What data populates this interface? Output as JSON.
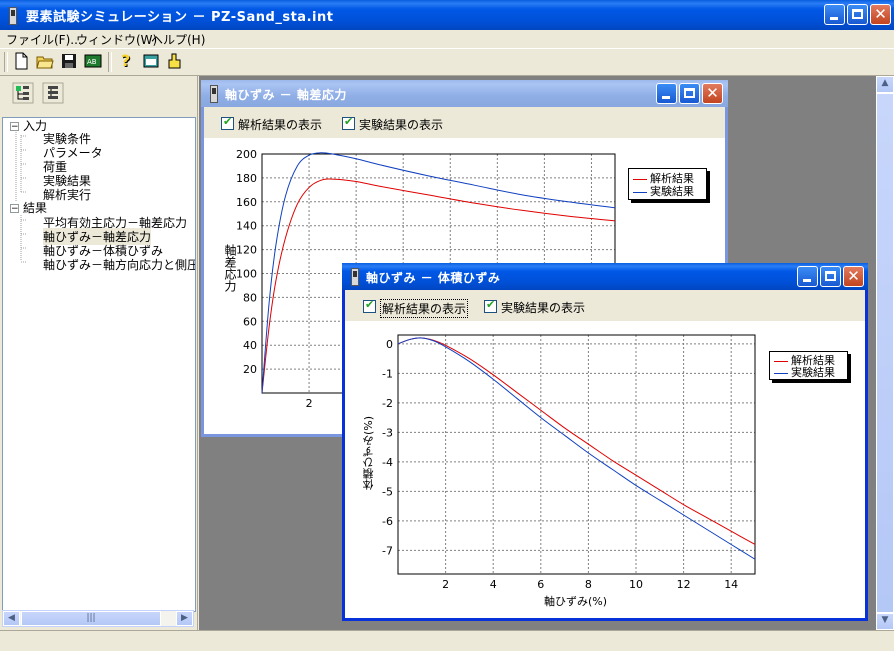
{
  "window": {
    "title": "要素試験シミュレーション － PZ-Sand_sta.int"
  },
  "menu": [
    "ファイル(F)...",
    "ウィンドウ(W)",
    "ヘルプ(H)"
  ],
  "toolbar": {
    "icons": [
      "new-file-icon",
      "open-folder-icon",
      "save-icon",
      "run-icon",
      "help-icon",
      "window-icon",
      "user-icon"
    ]
  },
  "tree": {
    "nodes": [
      {
        "label": "入力",
        "expander": "−"
      },
      {
        "label": "実験条件"
      },
      {
        "label": "パラメータ"
      },
      {
        "label": "荷重"
      },
      {
        "label": "実験結果"
      },
      {
        "label": "解析実行"
      },
      {
        "label": "結果",
        "expander": "−"
      },
      {
        "label": "平均有効主応力－軸差応力"
      },
      {
        "label": "軸ひずみ－軸差応力"
      },
      {
        "label": "軸ひずみ－体積ひずみ"
      },
      {
        "label": "軸ひずみ－軸方向応力と側圧"
      }
    ]
  },
  "win1": {
    "title": "軸ひずみ － 軸差応力",
    "check1": "解析結果の表示",
    "check2": "実験結果の表示",
    "ylabel": "軸差応力",
    "legend": [
      "解析結果",
      "実験結果"
    ]
  },
  "win2": {
    "title": "軸ひずみ － 体積ひずみ",
    "check1": "解析結果の表示",
    "check2": "実験結果の表示",
    "xlabel": "軸ひずみ(%)",
    "ylabel": "体積ひずみ(%)",
    "legend": [
      "解析結果",
      "実験結果"
    ]
  },
  "colors": {
    "analysis": "#e00000",
    "experiment": "#1040c0"
  },
  "chart_data": [
    {
      "type": "line",
      "title": "",
      "xlabel": "",
      "ylabel": "軸差応力",
      "x_ticks_visible": [
        2
      ],
      "y_ticks": [
        20,
        40,
        60,
        80,
        100,
        120,
        140,
        160,
        180,
        200
      ],
      "xlim": [
        0,
        15
      ],
      "ylim": [
        0,
        200
      ],
      "grid": true,
      "legend_position": "right",
      "series": [
        {
          "name": "解析結果",
          "x": [
            0,
            0.3,
            0.6,
            1,
            1.5,
            2,
            2.5,
            3,
            4,
            5,
            7,
            9,
            11,
            13,
            15
          ],
          "y": [
            0,
            55,
            95,
            130,
            158,
            172,
            178,
            179,
            177,
            173,
            166,
            159,
            153,
            148,
            144
          ]
        },
        {
          "name": "実験結果",
          "x": [
            0,
            0.3,
            0.6,
            1,
            1.5,
            2,
            2.5,
            3,
            4,
            5,
            7,
            9,
            11,
            13,
            15
          ],
          "y": [
            0,
            75,
            125,
            165,
            190,
            199,
            201,
            200,
            196,
            191,
            182,
            174,
            166,
            160,
            155
          ]
        }
      ]
    },
    {
      "type": "line",
      "title": "",
      "xlabel": "軸ひずみ(%)",
      "ylabel": "体積ひずみ(%)",
      "x_ticks": [
        2,
        4,
        6,
        8,
        10,
        12,
        14
      ],
      "y_ticks": [
        0,
        -1,
        -2,
        -3,
        -4,
        -5,
        -6,
        -7
      ],
      "xlim": [
        0,
        15
      ],
      "ylim": [
        -7.8,
        0.3
      ],
      "grid": true,
      "legend_position": "right",
      "series": [
        {
          "name": "解析結果",
          "x": [
            0,
            0.5,
            1,
            1.5,
            2,
            3,
            4,
            5,
            6,
            7,
            8,
            9,
            10,
            11,
            12,
            13,
            14,
            15
          ],
          "y": [
            0,
            0.15,
            0.2,
            0.12,
            -0.05,
            -0.5,
            -1.05,
            -1.65,
            -2.25,
            -2.85,
            -3.4,
            -3.95,
            -4.45,
            -4.95,
            -5.45,
            -5.9,
            -6.35,
            -6.8
          ]
        },
        {
          "name": "実験結果",
          "x": [
            0,
            0.5,
            1,
            1.5,
            2,
            3,
            4,
            5,
            6,
            7,
            8,
            9,
            10,
            11,
            12,
            13,
            14,
            15
          ],
          "y": [
            0,
            0.15,
            0.2,
            0.1,
            -0.1,
            -0.6,
            -1.2,
            -1.85,
            -2.5,
            -3.1,
            -3.7,
            -4.25,
            -4.8,
            -5.3,
            -5.8,
            -6.3,
            -6.8,
            -7.3
          ]
        }
      ]
    }
  ]
}
